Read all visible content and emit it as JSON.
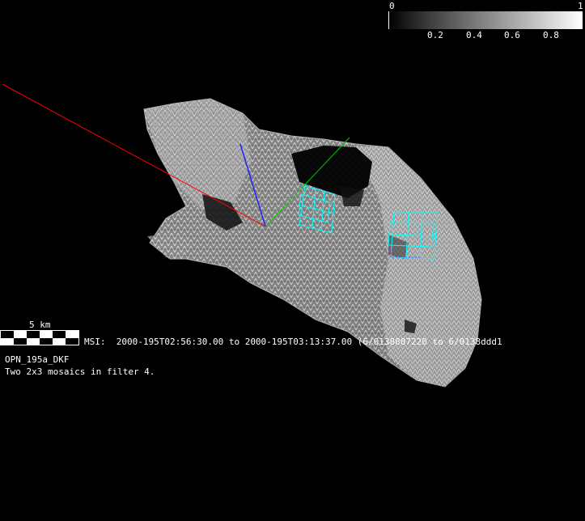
{
  "colorbar": {
    "min_label": "0",
    "max_label": "1",
    "tick_labels": [
      "0.2",
      "0.4",
      "0.6",
      "0.8"
    ]
  },
  "scale": {
    "label": "5 km"
  },
  "msi": {
    "prefix": "MSI:",
    "time_range": "2000-195T02:56:30.00 to 2000-195T03:13:37.00 (6/0138887220 to 6/0138ddd1"
  },
  "observation": {
    "id": "OPN_195a_DKF",
    "description": "Two 2x3 mosaics in filter 4."
  },
  "colors": {
    "background": "#000000",
    "axis_x": "#ff0000",
    "axis_y": "#00cc00",
    "axis_z": "#2222ff",
    "footprint": "#00ffff",
    "footprint_alt": "#ff00ff"
  },
  "icons": [
    "asteroid-shape-model",
    "axis-triad",
    "footprint-mosaic"
  ]
}
